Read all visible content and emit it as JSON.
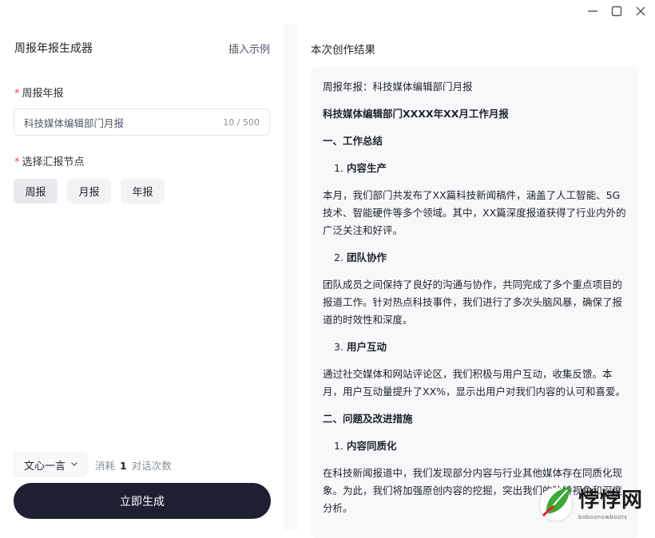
{
  "window": {
    "minimize_icon": "minimize-icon",
    "maximize_icon": "maximize-icon",
    "close_icon": "close-icon"
  },
  "left": {
    "title": "周报年报生成器",
    "insert_example": "插入示例",
    "report_label": "周报年报",
    "report_value": "科技媒体编辑部门月报",
    "report_count": "10 / 500",
    "node_label": "选择汇报节点",
    "nodes": [
      "周报",
      "月报",
      "年报"
    ],
    "selected_node": "周报",
    "model": "文心一言",
    "cost_prefix": "消耗",
    "cost_num": "1",
    "cost_suffix": "对话次数",
    "generate": "立即生成"
  },
  "right": {
    "title": "本次创作结果",
    "line1": "周报年报：科技媒体编辑部门月报",
    "doc_title": "科技媒体编辑部门XXXX年XX月工作月报",
    "sec1": "一、工作总结",
    "sub1_num": "1.",
    "sub1": "内容生产",
    "para1": "本月，我们部门共发布了XX篇科技新闻稿件，涵盖了人工智能、5G技术、智能硬件等多个领域。其中，XX篇深度报道获得了行业内外的广泛关注和好评。",
    "sub2_num": "2.",
    "sub2": "团队协作",
    "para2": "团队成员之间保持了良好的沟通与协作，共同完成了多个重点项目的报道工作。针对热点科技事件，我们进行了多次头脑风暴，确保了报道的时效性和深度。",
    "sub3_num": "3.",
    "sub3": "用户互动",
    "para3": "通过社交媒体和网站评论区，我们积极与用户互动，收集反馈。本月，用户互动量提升了XX%，显示出用户对我们内容的认可和喜爱。",
    "sec2": "二、问题及改进措施",
    "sub4_num": "1.",
    "sub4": "内容同质化",
    "para4": "在科技新闻报道中，我们发现部分内容与行业其他媒体存在同质化现象。为此，我们将加强原创内容的挖掘，突出我们的独特视角和深度分析。"
  },
  "watermark": {
    "text": "悖悖网",
    "sub": "bobosnowboots",
    "color": "#1a1a1a"
  }
}
